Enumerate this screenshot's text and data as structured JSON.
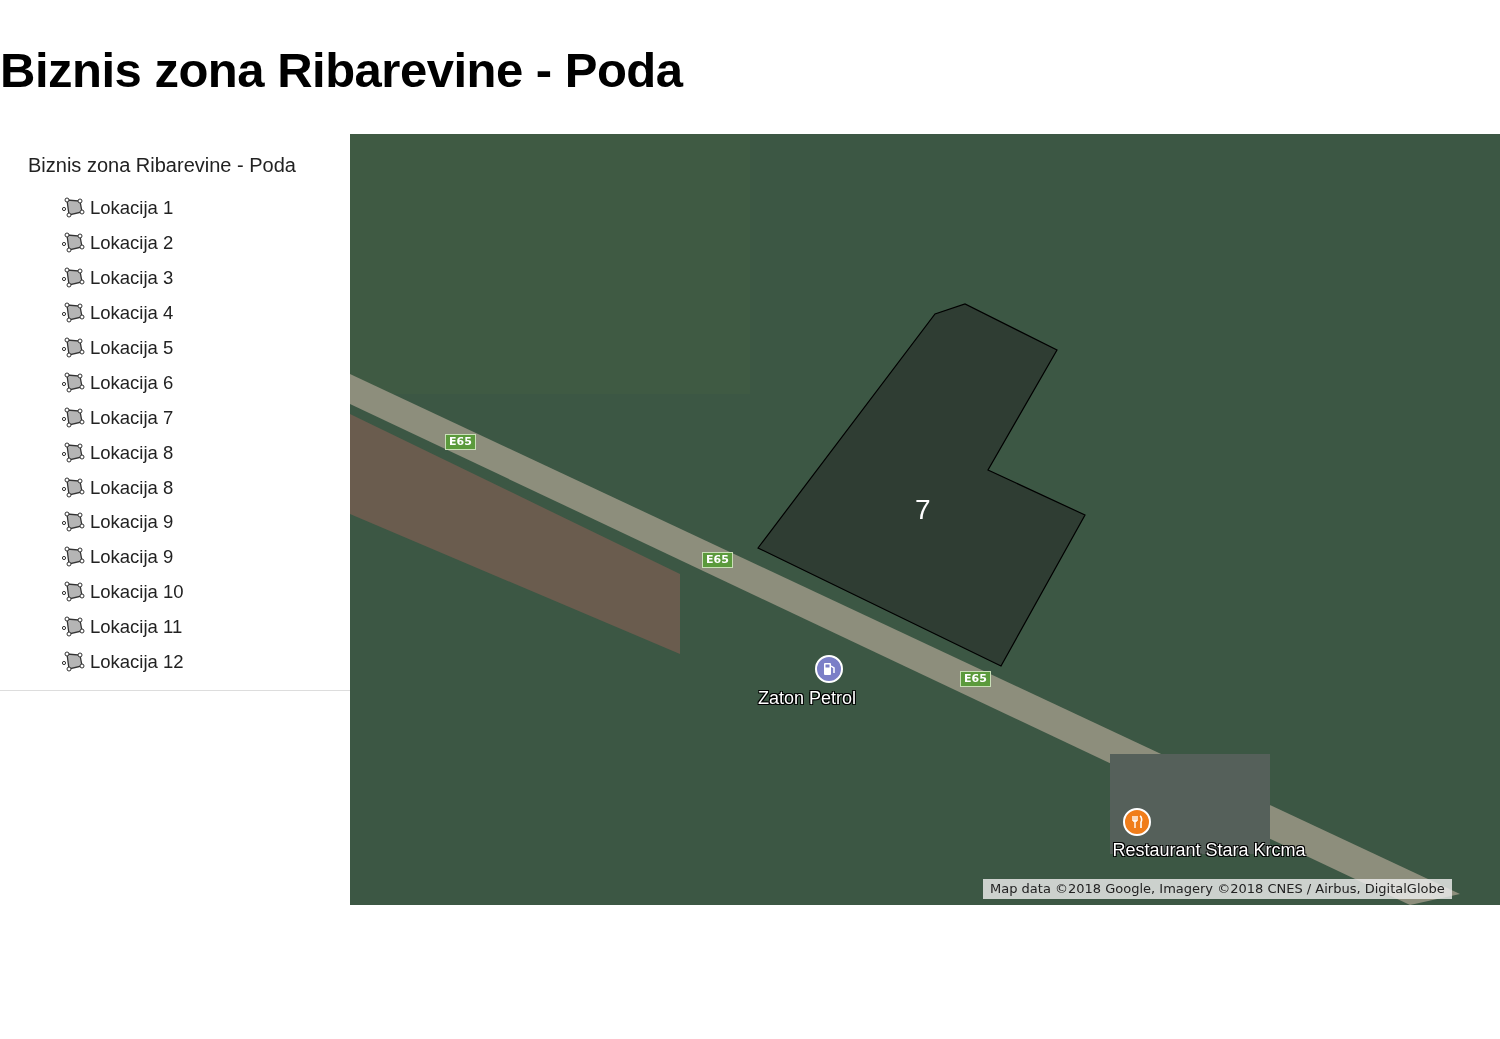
{
  "page_title": "Biznis zona Ribarevine - Poda",
  "sidebar": {
    "title": "Biznis zona Ribarevine - Poda",
    "items": [
      {
        "label": "Lokacija 1"
      },
      {
        "label": "Lokacija 2"
      },
      {
        "label": "Lokacija 3"
      },
      {
        "label": "Lokacija 4"
      },
      {
        "label": "Lokacija 5"
      },
      {
        "label": "Lokacija 6"
      },
      {
        "label": "Lokacija 7"
      },
      {
        "label": "Lokacija 8"
      },
      {
        "label": "Lokacija 8"
      },
      {
        "label": "Lokacija 9"
      },
      {
        "label": "Lokacija 9"
      },
      {
        "label": "Lokacija 10"
      },
      {
        "label": "Lokacija 11"
      },
      {
        "label": "Lokacija 12"
      }
    ]
  },
  "map": {
    "parcel_label": "7",
    "road_shields": [
      "E65",
      "E65",
      "E65"
    ],
    "places": [
      {
        "name": "Zaton Petrol",
        "kind": "fuel"
      },
      {
        "name": "Restaurant Stara Krcma",
        "kind": "restaurant"
      }
    ],
    "attribution": "Map data ©2018 Google, Imagery ©2018 CNES / Airbus, DigitalGlobe"
  }
}
